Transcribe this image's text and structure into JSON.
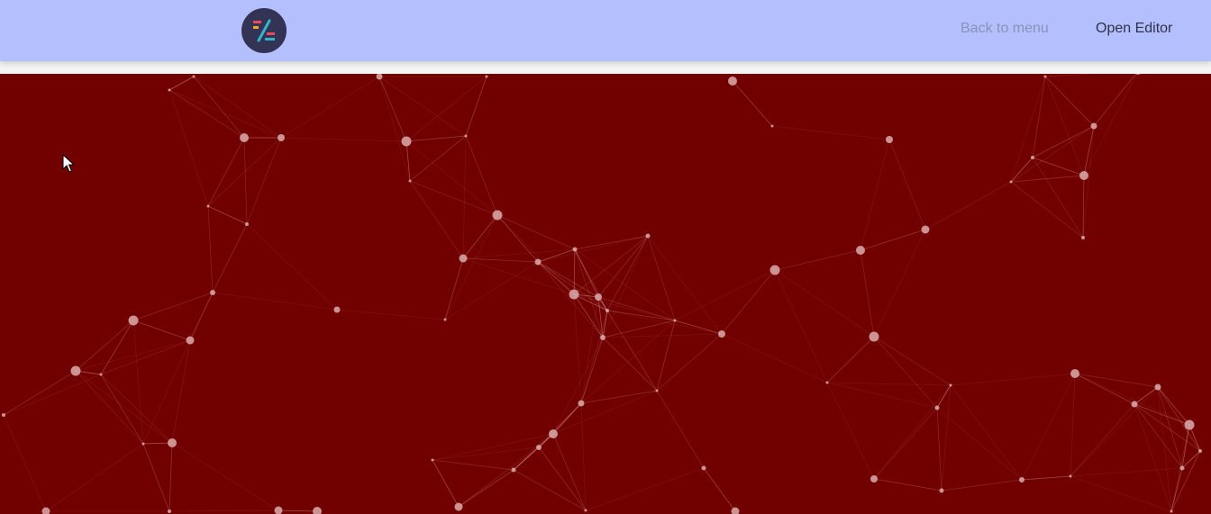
{
  "header": {
    "logo_name": "z-logo",
    "back_to_menu_label": "Back to menu",
    "open_editor_label": "Open Editor"
  },
  "colors": {
    "header_bg": "#b4bffe",
    "hero_bg": "#710000",
    "logo_bg": "#333355",
    "back_link": "#8a91b8",
    "editor_link": "#2e3348"
  },
  "icons": {
    "cursor": "arrow-cursor-icon"
  }
}
